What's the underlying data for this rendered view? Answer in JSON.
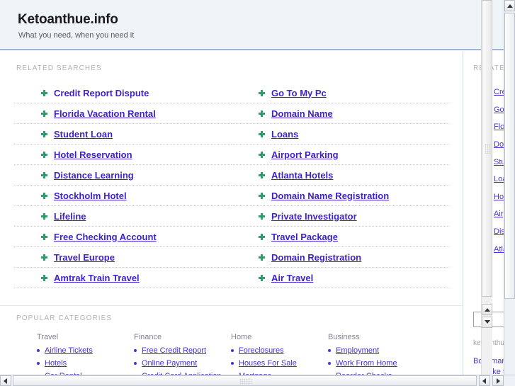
{
  "header": {
    "title": "Ketoanthue.info",
    "tagline": "What you need, when you need it"
  },
  "main": {
    "related_label": "RELATED SEARCHES",
    "left_links": [
      "Credit Report Dispute",
      "Florida Vacation Rental",
      "Student Loan",
      "Hotel Reservation",
      "Distance Learning",
      "Stockholm Hotel",
      "Lifeline",
      "Free Checking Account",
      "Travel Europe",
      "Amtrak Train Travel"
    ],
    "right_links": [
      "Go To My Pc",
      "Domain Name",
      "Loans",
      "Airport Parking",
      "Atlanta Hotels",
      "Domain Name Registration",
      "Private Investigator",
      "Travel Package",
      "Domain Registration",
      "Air Travel"
    ]
  },
  "popular": {
    "label": "POPULAR CATEGORIES",
    "columns": [
      {
        "title": "Travel",
        "items": [
          "Airline Tickets",
          "Hotels",
          "Car Rental"
        ]
      },
      {
        "title": "Finance",
        "items": [
          "Free Credit Report",
          "Online Payment",
          "Credit Card Application"
        ]
      },
      {
        "title": "Home",
        "items": [
          "Foreclosures",
          "Houses For Sale",
          "Mortgage"
        ]
      },
      {
        "title": "Business",
        "items": [
          "Employment",
          "Work From Home",
          "Reorder Checks"
        ]
      }
    ]
  },
  "sidebar": {
    "label": "RELATED SEARCHES",
    "links": [
      "Credit Report Dispute",
      "Go To My Pc",
      "Florida Vacation Rental",
      "Domain Name",
      "Student Loan",
      "Loans",
      "Hotel Reservation",
      "Airport Parking",
      "Distance Learning",
      "Atlanta Hotels"
    ],
    "search_value": "",
    "search_placeholder": "",
    "domain_text": "ketoanthue.info",
    "bookmark_label": "Bookmark this page",
    "homepage_label": "Make this my homepage"
  },
  "colors": {
    "link": "#3f22c8",
    "sidebar_link": "#4b2fd0",
    "bullet_green": "#2f9c6e",
    "header_bg": "#eff4f8",
    "header_rule": "#9fb4d8"
  },
  "icons": {
    "plus_bullet": "plus-bullet-icon",
    "dot_bullet": "dot-bullet-icon",
    "scroll_up": "triangle-up-icon",
    "scroll_down": "triangle-down-icon",
    "scroll_left": "triangle-left-icon",
    "scroll_right": "triangle-right-icon"
  }
}
